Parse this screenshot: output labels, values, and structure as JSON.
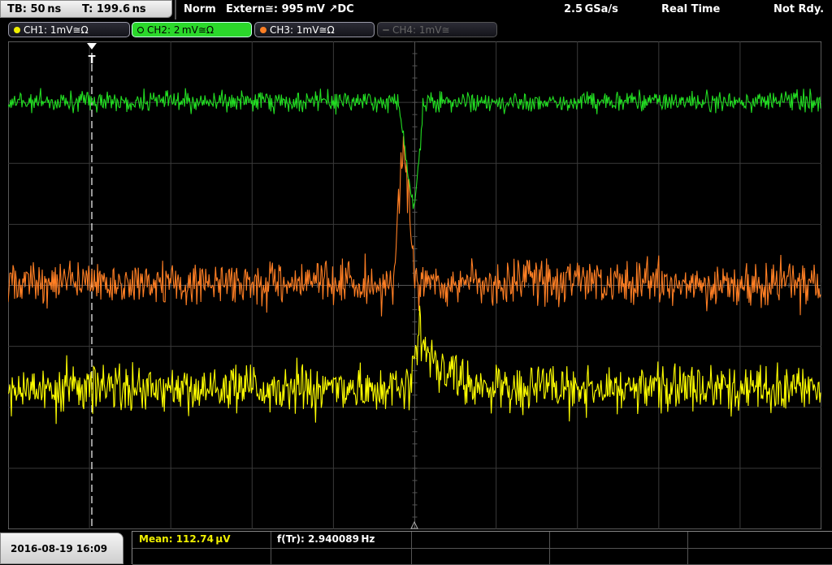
{
  "header": {
    "timebase": "TB: 50 ns",
    "trigger_time": "T: 199.6 ns",
    "mode": "Norm",
    "trigger_source": "Extern≅: 995 mV ↗DC",
    "sample_rate": "2.5 GSa/s",
    "acq_mode": "Real Time",
    "status": "Not Rdy."
  },
  "channels": [
    {
      "label": "CH1: 1mV≅Ω",
      "color": "#f0f000",
      "state": "on"
    },
    {
      "label": "CH2: 2 mV≅Ω",
      "color": "#22dd22",
      "state": "selected"
    },
    {
      "label": "CH3: 1mV≅Ω",
      "color": "#ff7f24",
      "state": "on"
    },
    {
      "label": "CH4: 1mV≅",
      "color": "#555555",
      "state": "off"
    }
  ],
  "trace_colors": {
    "ch1": "#ffff00",
    "ch2": "#22dd22",
    "ch3": "#ff7f24"
  },
  "footer": {
    "datetime": "2016-08-19 16:09",
    "mean_label": "Mean: 112.74 µV",
    "freq_label": "f(Tr): 2.940089 Hz"
  },
  "icons": {
    "trigger_marker": "trigger-t-icon",
    "trigger_arrow": "trigger-arrow-icon"
  }
}
